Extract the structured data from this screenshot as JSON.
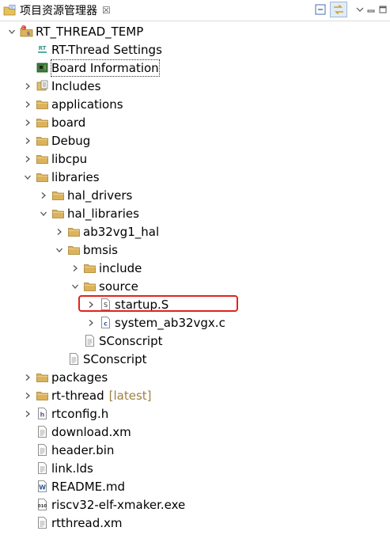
{
  "view": {
    "title": "项目资源管理器",
    "close_glyph": "☒",
    "toolbar": [
      {
        "name": "collapse-all-button",
        "icon": "collapse-all-icon"
      },
      {
        "name": "link-with-editor-button",
        "icon": "link-with-editor-icon"
      },
      {
        "name": "view-menu-button",
        "icon": "view-menu-icon"
      },
      {
        "name": "minimize-button",
        "icon": "minimize-icon"
      },
      {
        "name": "maximize-button",
        "icon": "maximize-icon"
      }
    ]
  },
  "tree": [
    {
      "label": "RT_THREAD_TEMP",
      "level": 0,
      "twisty": "expanded",
      "icon": "project"
    },
    {
      "label": "RT-Thread Settings",
      "level": 1,
      "twisty": "none",
      "icon": "rt-settings"
    },
    {
      "label": "Board Information",
      "level": 1,
      "twisty": "none",
      "icon": "board-info",
      "selected": true
    },
    {
      "label": "Includes",
      "level": 1,
      "twisty": "collapsed",
      "icon": "includes"
    },
    {
      "label": "applications",
      "level": 1,
      "twisty": "collapsed",
      "icon": "folder"
    },
    {
      "label": "board",
      "level": 1,
      "twisty": "collapsed",
      "icon": "folder"
    },
    {
      "label": "Debug",
      "level": 1,
      "twisty": "collapsed",
      "icon": "folder"
    },
    {
      "label": "libcpu",
      "level": 1,
      "twisty": "collapsed",
      "icon": "folder"
    },
    {
      "label": "libraries",
      "level": 1,
      "twisty": "expanded",
      "icon": "folder"
    },
    {
      "label": "hal_drivers",
      "level": 2,
      "twisty": "collapsed",
      "icon": "folder"
    },
    {
      "label": "hal_libraries",
      "level": 2,
      "twisty": "expanded",
      "icon": "folder"
    },
    {
      "label": "ab32vg1_hal",
      "level": 3,
      "twisty": "collapsed",
      "icon": "folder"
    },
    {
      "label": "bmsis",
      "level": 3,
      "twisty": "expanded",
      "icon": "folder"
    },
    {
      "label": "include",
      "level": 4,
      "twisty": "collapsed",
      "icon": "folder"
    },
    {
      "label": "source",
      "level": 4,
      "twisty": "expanded",
      "icon": "folder"
    },
    {
      "label": "startup.S",
      "level": 5,
      "twisty": "collapsed",
      "icon": "asm-file",
      "highlighted": true
    },
    {
      "label": "system_ab32vgx.c",
      "level": 5,
      "twisty": "collapsed",
      "icon": "c-file"
    },
    {
      "label": "SConscript",
      "level": 4,
      "twisty": "none",
      "icon": "text-file"
    },
    {
      "label": "SConscript",
      "level": 3,
      "twisty": "none",
      "icon": "text-file"
    },
    {
      "label": "packages",
      "level": 1,
      "twisty": "collapsed",
      "icon": "folder"
    },
    {
      "label": "rt-thread",
      "level": 1,
      "twisty": "collapsed",
      "icon": "folder",
      "decoration": "[latest]"
    },
    {
      "label": "rtconfig.h",
      "level": 1,
      "twisty": "collapsed",
      "icon": "h-file"
    },
    {
      "label": "download.xm",
      "level": 1,
      "twisty": "none",
      "icon": "text-file"
    },
    {
      "label": "header.bin",
      "level": 1,
      "twisty": "none",
      "icon": "text-file"
    },
    {
      "label": "link.lds",
      "level": 1,
      "twisty": "none",
      "icon": "text-file"
    },
    {
      "label": "README.md",
      "level": 1,
      "twisty": "none",
      "icon": "word-file"
    },
    {
      "label": "riscv32-elf-xmaker.exe",
      "level": 1,
      "twisty": "none",
      "icon": "exe-file"
    },
    {
      "label": "rtthread.xm",
      "level": 1,
      "twisty": "none",
      "icon": "text-file"
    }
  ],
  "colors": {
    "highlight_border": "#e3221c",
    "folder": "#dcb35c",
    "decoration": "#9e8144"
  }
}
